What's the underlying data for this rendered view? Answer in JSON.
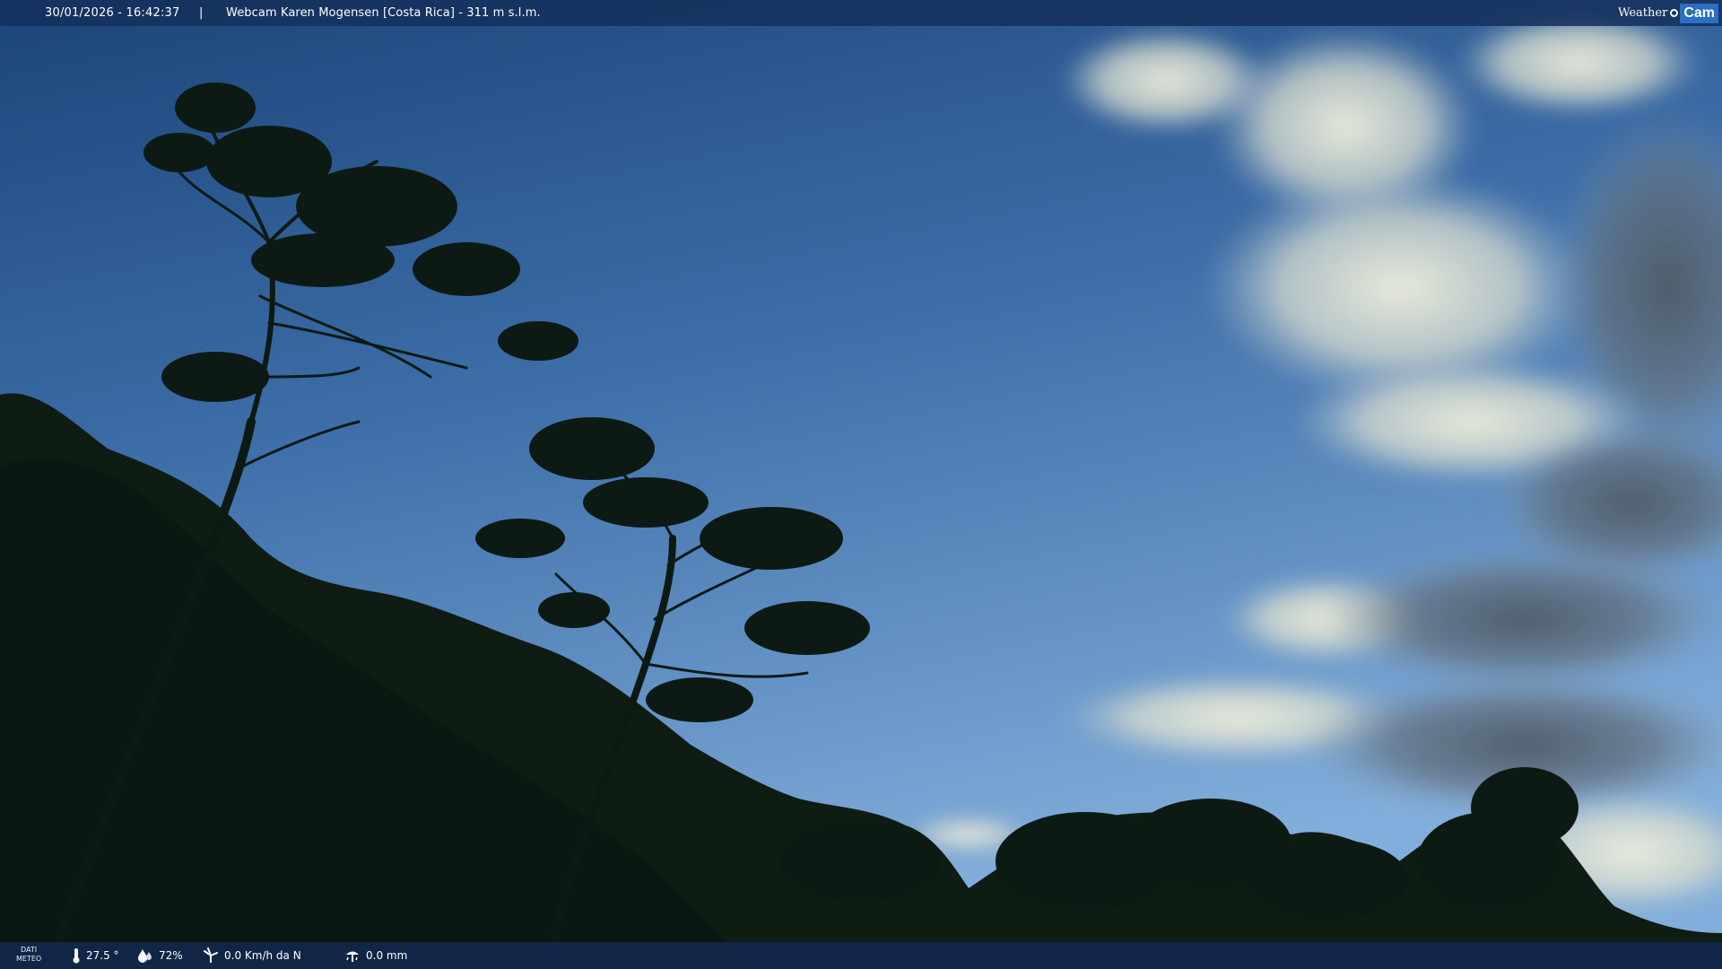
{
  "header": {
    "timestamp": "30/01/2026 - 16:42:37",
    "separator": "|",
    "title": "Webcam Karen Mogensen [Costa Rica] - 311 m s.l.m."
  },
  "brand": {
    "part1": "Weather",
    "part2": "Cam"
  },
  "footer": {
    "dati_line1": "DATI",
    "dati_line2": "METEO",
    "temperature": "27.5 °",
    "humidity": "72%",
    "wind": "0.0 Km/h da N",
    "rain": "0.0 mm"
  },
  "colors": {
    "sky_top": "#1f4a7f",
    "sky_bottom": "#6f9fd0",
    "bar_bg": "#16305c",
    "brand_accent": "#2a6fc4"
  },
  "icons": {
    "temperature": "thermometer-icon",
    "humidity": "humidity-drop-icon",
    "wind": "wind-turbine-icon",
    "rain": "rain-gauge-icon"
  }
}
